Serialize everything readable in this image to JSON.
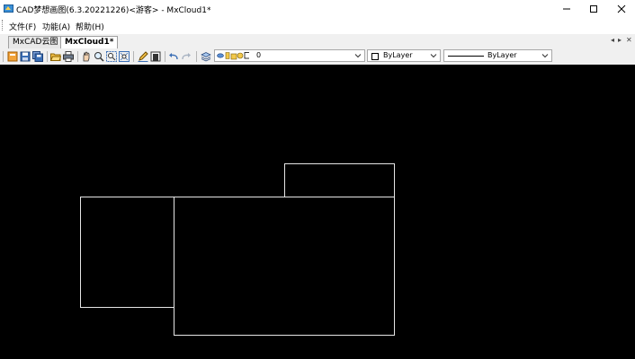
{
  "window": {
    "title": "CAD梦想画图(6.3.20221226)<游客> - MxCloud1*",
    "minimize_icon": "minimize-icon",
    "maximize_icon": "maximize-icon",
    "close_icon": "close-icon"
  },
  "menu": {
    "items": [
      "文件(F)",
      "功能(A)",
      "帮助(H)"
    ]
  },
  "tabs": {
    "items": [
      {
        "label": "MxCAD云图",
        "active": false
      },
      {
        "label": "MxCloud1*",
        "active": true
      }
    ],
    "nav_prev": "◂",
    "nav_next": "▸",
    "close": "✕"
  },
  "toolbar": {
    "icons": [
      "new-icon",
      "save-icon",
      "save-all-icon",
      "open-icon",
      "print-icon",
      "pan-icon",
      "zoom-icon",
      "zoom-extents-icon",
      "zoom-window-icon",
      "edit-icon",
      "erase-icon",
      "undo-icon",
      "redo-icon",
      "layer-manager-icon"
    ],
    "layer_value": "0",
    "color_value": "ByLayer",
    "linetype_value": "ByLayer"
  },
  "colors": {
    "canvas_background": "#000000",
    "entity_stroke": "#e6e6e6"
  }
}
